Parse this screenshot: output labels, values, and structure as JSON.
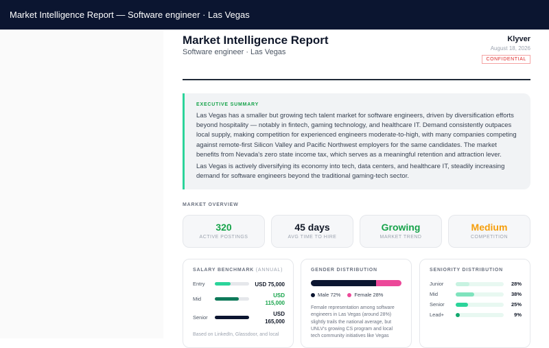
{
  "window": {
    "title": "Market Intelligence Report — Software engineer · Las Vegas"
  },
  "report": {
    "title": "Market Intelligence Report",
    "subtitle": "Software engineer · Las Vegas",
    "brand": "Klyver",
    "date": "August 18, 2026",
    "badge": "CONFIDENTIAL"
  },
  "executive_summary": {
    "label": "EXECUTIVE SUMMARY",
    "paragraph1": "Las Vegas has a smaller but growing tech talent market for software engineers, driven by diversification efforts beyond hospitality — notably in fintech, gaming technology, and healthcare IT. Demand consistently outpaces local supply, making competition for experienced engineers moderate-to-high, with many companies competing against remote-first Silicon Valley and Pacific Northwest employers for the same candidates. The market benefits from Nevada's zero state income tax, which serves as a meaningful retention and attraction lever.",
    "paragraph2": "Las Vegas is actively diversifying its economy into tech, data centers, and healthcare IT, steadily increasing demand for software engineers beyond the traditional gaming-tech sector."
  },
  "market_overview": {
    "label": "MARKET OVERVIEW",
    "metrics": [
      {
        "value": "320",
        "label": "ACTIVE POSTINGS",
        "color": "#16a34a"
      },
      {
        "value": "45 days",
        "label": "AVG TIME TO HIRE",
        "color": "#111827"
      },
      {
        "value": "Growing",
        "label": "MARKET TREND",
        "color": "#16a34a"
      },
      {
        "value": "Medium",
        "label": "COMPETITION",
        "color": "#f59e0b"
      }
    ]
  },
  "salary_benchmark": {
    "title": "SALARY BENCHMARK",
    "title_suffix": "(ANNUAL)",
    "rows": [
      {
        "level": "Entry",
        "value": "USD 75,000",
        "fill": 0.45,
        "fill_color": "#2bd49a",
        "highlight": false
      },
      {
        "level": "Mid",
        "value_line1": "USD",
        "value_line2": "115,000",
        "fill": 0.7,
        "fill_color": "#0f7a5a",
        "highlight": true
      },
      {
        "level": "Senior",
        "value_line1": "USD",
        "value_line2": "165,000",
        "fill": 1.0,
        "fill_color": "#0b1530",
        "highlight": false
      }
    ],
    "footnote": "Based on LinkedIn, Glassdoor, and local"
  },
  "gender_distribution": {
    "title": "GENDER DISTRIBUTION",
    "male_pct": 72,
    "female_pct": 28,
    "male_label": "Male 72%",
    "female_label": "Female 28%",
    "male_color": "#0b1530",
    "female_color": "#ec4899",
    "note": "Female representation among software engineers in Las Vegas (around 28%) slightly trails the national average, but UNLV's growing CS program and local tech community initiatives like Vegas"
  },
  "seniority_distribution": {
    "title": "SENIORITY DISTRIBUTION",
    "rows": [
      {
        "level": "Junior",
        "pct": "28%",
        "fill": 0.28,
        "color": "#c7f2e1"
      },
      {
        "level": "Mid",
        "pct": "38%",
        "fill": 0.38,
        "color": "#7fe3bd"
      },
      {
        "level": "Senior",
        "pct": "25%",
        "fill": 0.25,
        "color": "#2bd49a"
      },
      {
        "level": "Lead+",
        "pct": "9%",
        "fill": 0.09,
        "color": "#12a86e"
      }
    ]
  }
}
